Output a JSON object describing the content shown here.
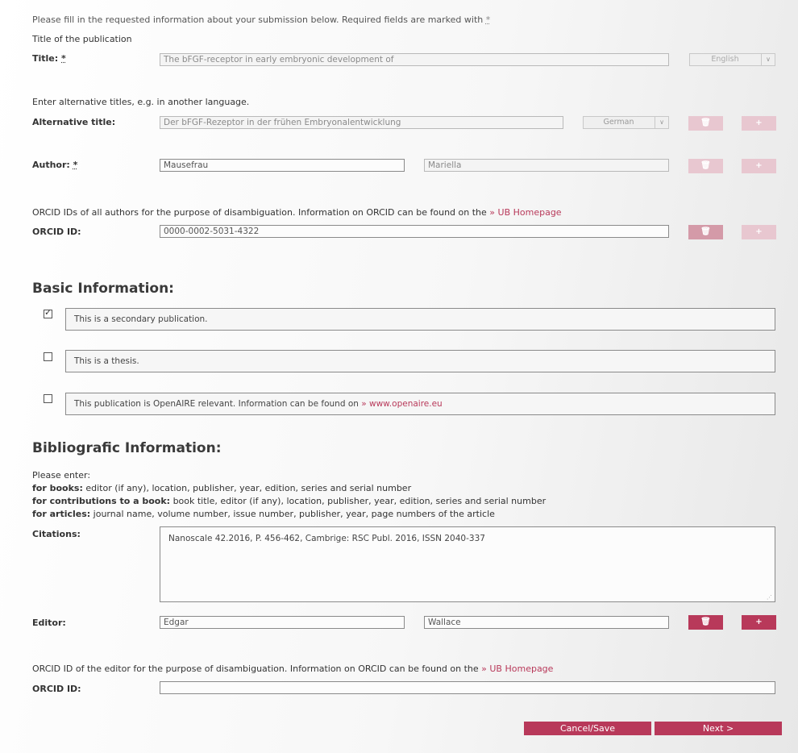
{
  "intro": {
    "text": "Please fill in the requested information about your submission below. Required fields are marked with",
    "req_marker": "*"
  },
  "title_section": {
    "heading": "Title of the publication",
    "label": "Title:",
    "req_marker": "*",
    "value": "The bFGF-receptor in early embryonic development of",
    "language": "English"
  },
  "alt_title": {
    "hint": "Enter alternative titles, e.g. in another language.",
    "label": "Alternative title:",
    "value": "Der bFGF-Rezeptor in der frühen Embryonalentwicklung",
    "language": "German"
  },
  "author": {
    "label": "Author:",
    "req_marker": "*",
    "last_name": "Mausefrau",
    "first_name": "Mariella"
  },
  "orcid_authors": {
    "hint": "ORCID IDs of all authors for the purpose of disambiguation. Information on ORCID can be found on the",
    "link": "» UB Homepage",
    "label": "ORCID ID:",
    "value": "0000-0002-5031-4322"
  },
  "basic": {
    "heading": "Basic Information:",
    "options": [
      {
        "text": "This is a secondary publication.",
        "checked": true
      },
      {
        "text": "This is a thesis.",
        "checked": false
      },
      {
        "text": "This publication is OpenAIRE relevant. Information can be found on",
        "link": "» www.openaire.eu",
        "checked": false
      }
    ]
  },
  "biblio": {
    "heading": "Bibliografic Information:",
    "please": "Please enter:",
    "books_b": "for books:",
    "books": "editor (if any), location, publisher, year, edition, series and serial number",
    "contrib_b": "for contributions to a book:",
    "contrib": "book title, editor (if any), location, publisher, year, edition, series and serial number",
    "articles_b": "for articles:",
    "articles": "journal name, volume number, issue number, publisher, year, page numbers of the article",
    "citations_label": "Citations:",
    "citations_value": "Nanoscale 42.2016, P. 456-462, Cambrige: RSC Publ. 2016, ISSN 2040-337"
  },
  "editor": {
    "label": "Editor:",
    "last_name": "Edgar",
    "first_name": "Wallace"
  },
  "orcid_editor": {
    "hint": "ORCID ID of the editor for the purpose of disambiguation. Information on ORCID can be found on the",
    "link": "» UB Homepage",
    "label": "ORCID ID:",
    "value": ""
  },
  "buttons": {
    "delete": "🗑",
    "add": "+",
    "cancel_save": "Cancel/Save",
    "next": "Next >"
  },
  "colors": {
    "accent": "#b8395a",
    "accent_faint": "#e8c7d0"
  }
}
